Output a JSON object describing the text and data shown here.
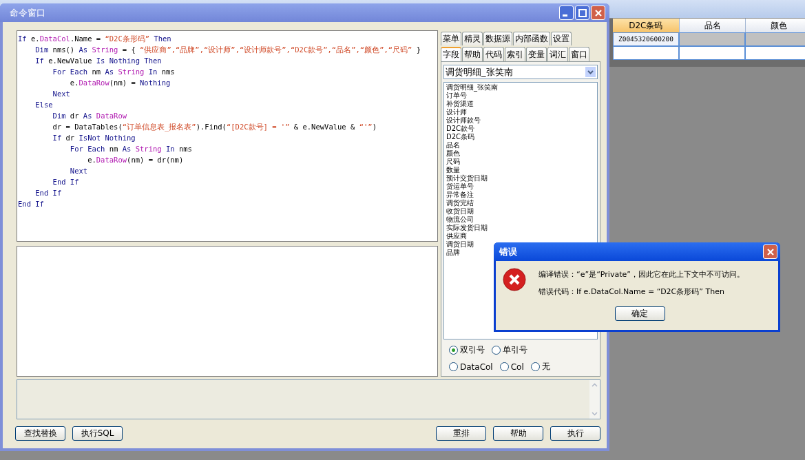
{
  "background_grid": {
    "columns": [
      {
        "label": "D2C条码",
        "selected": true
      },
      {
        "label": "品名",
        "selected": false
      },
      {
        "label": "颜色",
        "selected": false
      }
    ],
    "rows": [
      {
        "code": "Z0045320600200",
        "selected": true
      },
      {
        "selected": false
      }
    ]
  },
  "window": {
    "title": "命令窗口",
    "code_lines": [
      [
        {
          "kind": "kw",
          "t": "If"
        },
        {
          "kind": "p",
          "t": " e."
        },
        {
          "kind": "prop",
          "t": "DataCol"
        },
        {
          "kind": "p",
          "t": ".Name = "
        },
        {
          "kind": "str",
          "t": "“D2C条形码”"
        },
        {
          "kind": "kw",
          "t": " Then"
        }
      ],
      [
        {
          "kind": "kw",
          "t": "    Dim"
        },
        {
          "kind": "p",
          "t": " nms() "
        },
        {
          "kind": "kw",
          "t": "As"
        },
        {
          "kind": "prop",
          "t": " String"
        },
        {
          "kind": "p",
          "t": " = { "
        },
        {
          "kind": "str",
          "t": "“供应商”,“品牌”,“设计师”,“设计师款号”,“D2C款号”,“品名”,“颜色”,“尺码”"
        },
        {
          "kind": "p",
          "t": " }"
        }
      ],
      [
        {
          "kind": "kw",
          "t": "    If"
        },
        {
          "kind": "p",
          "t": " e.NewValue "
        },
        {
          "kind": "kw",
          "t": "Is Nothing Then"
        }
      ],
      [
        {
          "kind": "kw",
          "t": "        For Each"
        },
        {
          "kind": "p",
          "t": " nm "
        },
        {
          "kind": "kw",
          "t": "As"
        },
        {
          "kind": "prop",
          "t": " String"
        },
        {
          "kind": "kw",
          "t": " In"
        },
        {
          "kind": "p",
          "t": " nms"
        }
      ],
      [
        {
          "kind": "p",
          "t": "            e."
        },
        {
          "kind": "prop",
          "t": "DataRow"
        },
        {
          "kind": "p",
          "t": "(nm) = "
        },
        {
          "kind": "kw",
          "t": "Nothing"
        }
      ],
      [
        {
          "kind": "kw",
          "t": "        Next"
        }
      ],
      [
        {
          "kind": "kw",
          "t": "    Else"
        }
      ],
      [
        {
          "kind": "kw",
          "t": "        Dim"
        },
        {
          "kind": "p",
          "t": " dr "
        },
        {
          "kind": "kw",
          "t": "As"
        },
        {
          "kind": "prop",
          "t": " DataRow"
        }
      ],
      [
        {
          "kind": "p",
          "t": "        dr = DataTables("
        },
        {
          "kind": "str",
          "t": "“订单信息表_报名表”"
        },
        {
          "kind": "p",
          "t": ").Find("
        },
        {
          "kind": "str",
          "t": "“[D2C款号] = '”"
        },
        {
          "kind": "p",
          "t": " & e.NewValue & "
        },
        {
          "kind": "str",
          "t": "“'”"
        },
        {
          "kind": "p",
          "t": ")"
        }
      ],
      [
        {
          "kind": "kw",
          "t": "        If"
        },
        {
          "kind": "p",
          "t": " dr "
        },
        {
          "kind": "kw",
          "t": "IsNot Nothing"
        }
      ],
      [
        {
          "kind": "kw",
          "t": "            For Each"
        },
        {
          "kind": "p",
          "t": " nm "
        },
        {
          "kind": "kw",
          "t": "As"
        },
        {
          "kind": "prop",
          "t": " String"
        },
        {
          "kind": "kw",
          "t": " In"
        },
        {
          "kind": "p",
          "t": " nms"
        }
      ],
      [
        {
          "kind": "p",
          "t": "                e."
        },
        {
          "kind": "prop",
          "t": "DataRow"
        },
        {
          "kind": "p",
          "t": "(nm) = dr(nm)"
        }
      ],
      [
        {
          "kind": "kw",
          "t": "            Next"
        }
      ],
      [
        {
          "kind": "kw",
          "t": "        End If"
        }
      ],
      [
        {
          "kind": "kw",
          "t": "    End If"
        }
      ],
      [
        {
          "kind": "kw",
          "t": "End If"
        }
      ]
    ],
    "tabs_row_1": [
      {
        "label": "菜单",
        "selected": false
      },
      {
        "label": "精灵",
        "selected": false
      },
      {
        "label": "数据源",
        "selected": false
      },
      {
        "label": "内部函数",
        "selected": false
      },
      {
        "label": "设置",
        "selected": false
      }
    ],
    "tabs_row_2": [
      {
        "label": "字段",
        "selected": true
      },
      {
        "label": "帮助",
        "selected": false
      },
      {
        "label": "代码",
        "selected": false
      },
      {
        "label": "索引",
        "selected": false
      },
      {
        "label": "变量",
        "selected": false
      },
      {
        "label": "词汇",
        "selected": false
      },
      {
        "label": "窗口",
        "selected": false
      }
    ],
    "table_select": {
      "value": "调货明细_张笑南"
    },
    "fields": [
      "调货明细_张笑南",
      "订单号",
      "补货渠道",
      "设计师",
      "设计师款号",
      "D2C款号",
      "D2C条码",
      "品名",
      "颜色",
      "尺码",
      "数量",
      "预计交货日期",
      "货运单号",
      "异常备注",
      "调货完结",
      "收货日期",
      "物流公司",
      "实际发货日期",
      "供应商",
      "调货日期",
      "品牌"
    ],
    "quote_options": [
      [
        {
          "label": "双引号",
          "selected": true
        },
        {
          "label": "单引号",
          "selected": false
        }
      ],
      [
        {
          "label": "DataCol",
          "selected": false
        },
        {
          "label": "Col",
          "selected": false
        },
        {
          "label": "无",
          "selected": false
        }
      ]
    ],
    "left_buttons": [
      "查找替换",
      "执行SQL"
    ],
    "right_buttons": [
      "重排",
      "帮助",
      "执行"
    ]
  },
  "error_dialog": {
    "title": "错误",
    "message": "编译错误：“e”是“Private”，因此它在此上下文中不可访问。",
    "code_line": "错误代码：If e.DataCol.Name = “D2C条形码” Then",
    "button": "确定"
  }
}
